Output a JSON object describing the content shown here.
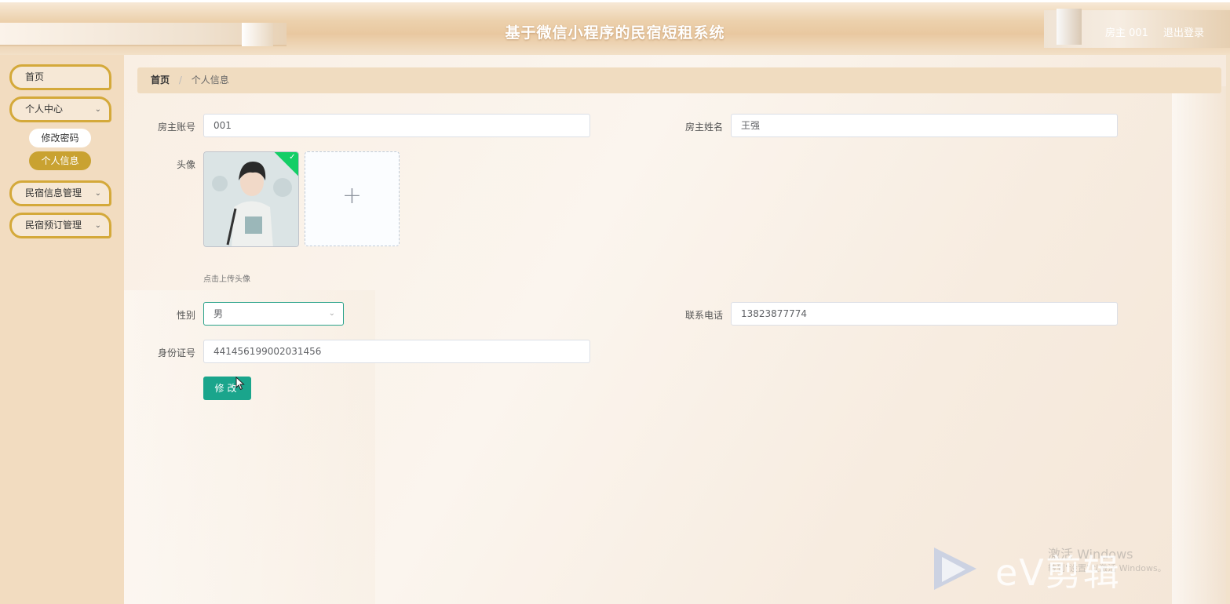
{
  "header": {
    "title": "基于微信小程序的民宿短租系统",
    "user": "房主 001",
    "logout": "退出登录"
  },
  "sidebar": {
    "items": [
      {
        "label": "首页"
      },
      {
        "label": "个人中心",
        "expanded": true,
        "children": [
          {
            "label": "修改密码",
            "active": false
          },
          {
            "label": "个人信息",
            "active": true
          }
        ]
      },
      {
        "label": "民宿信息管理"
      },
      {
        "label": "民宿预订管理"
      }
    ]
  },
  "breadcrumb": {
    "home": "首页",
    "separator": "/",
    "current": "个人信息"
  },
  "form": {
    "account_label": "房主账号",
    "account_value": "001",
    "name_label": "房主姓名",
    "name_value": "王强",
    "avatar_label": "头像",
    "upload_tip": "点击上传头像",
    "gender_label": "性别",
    "gender_value": "男",
    "phone_label": "联系电话",
    "phone_value": "13823877774",
    "id_label": "身份证号",
    "id_value": "441456199002031456",
    "submit": "修改"
  },
  "watermark": {
    "line1": "激活 Windows",
    "line2": "转到\"设置\"以激活 Windows。",
    "brand": "eV剪辑"
  },
  "colors": {
    "accent_gold": "#c9a231",
    "primary_green": "#1aa58c",
    "header_bg": "#e9c8a0",
    "sidebar_bg": "#f2dcc0"
  }
}
